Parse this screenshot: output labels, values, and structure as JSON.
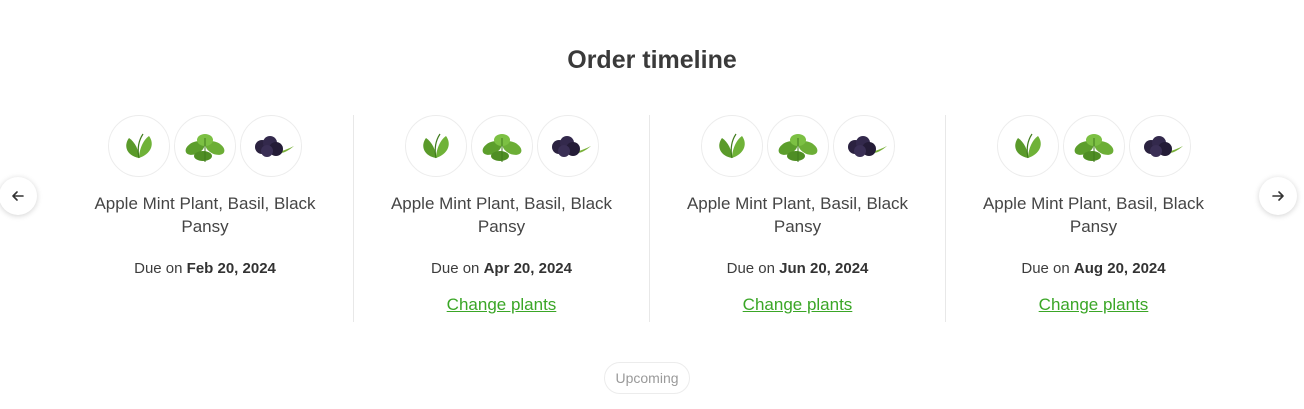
{
  "title": "Order timeline",
  "nav": {
    "prev_icon": "arrow-left-icon",
    "next_icon": "arrow-right-icon"
  },
  "colors": {
    "link": "#3aa626",
    "text": "#3d3d3d",
    "badge_text": "#9a9a9a"
  },
  "cards": [
    {
      "plants_text": "Apple Mint Plant, Basil, Black Pansy",
      "due_prefix": "Due on",
      "due_date": "Feb 20, 2024",
      "change_label": ""
    },
    {
      "plants_text": "Apple Mint Plant, Basil, Black Pansy",
      "due_prefix": "Due on",
      "due_date": "Apr 20, 2024",
      "change_label": "Change plants"
    },
    {
      "plants_text": "Apple Mint Plant, Basil, Black Pansy",
      "due_prefix": "Due on",
      "due_date": "Jun 20, 2024",
      "change_label": "Change plants"
    },
    {
      "plants_text": "Apple Mint Plant, Basil, Black Pansy",
      "due_prefix": "Due on",
      "due_date": "Aug 20, 2024",
      "change_label": "Change plants"
    }
  ],
  "thumbnails": [
    "mint-leaf-icon",
    "basil-leaf-icon",
    "black-pansy-icon"
  ],
  "status_badge": "Upcoming"
}
